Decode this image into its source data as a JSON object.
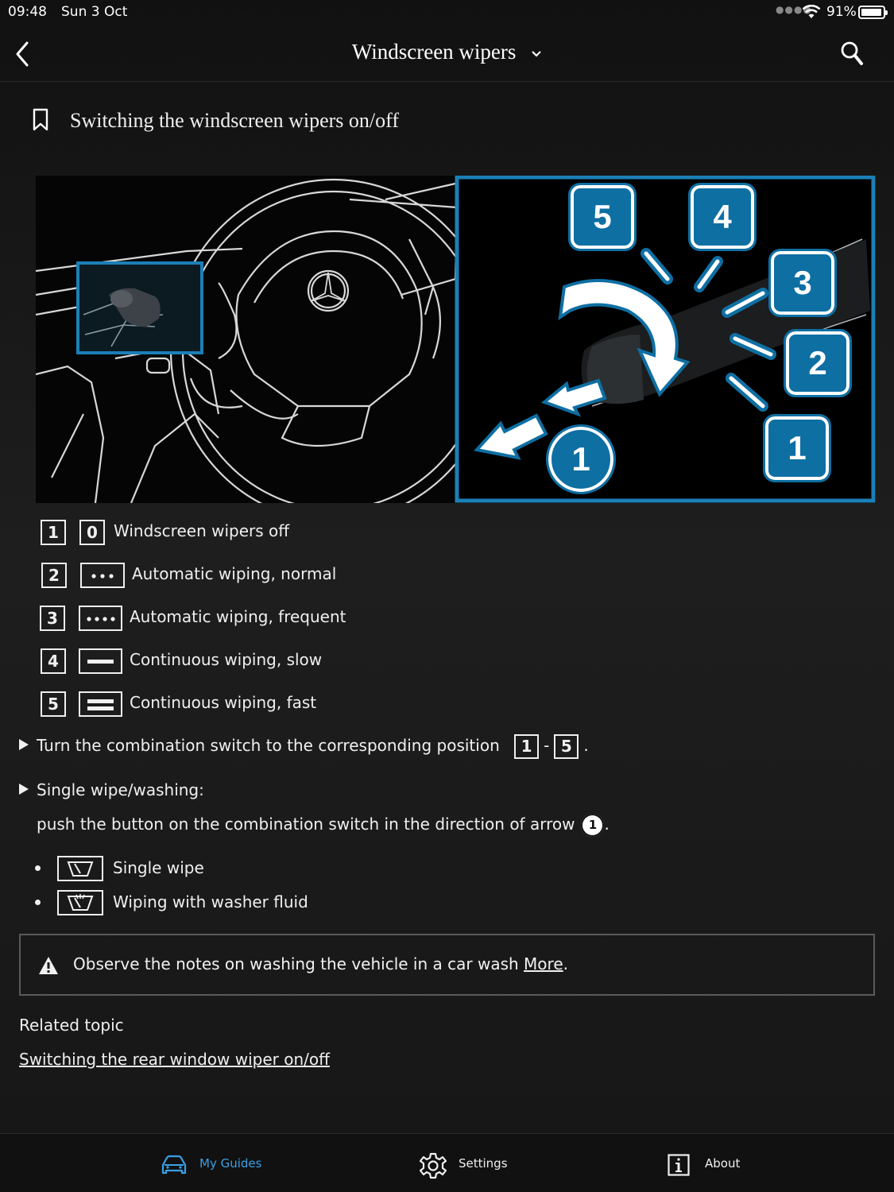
{
  "status_bar": {
    "time": "09:48",
    "date": "Sun 3 Oct",
    "battery": "91%",
    "battery_level": 0.91
  },
  "nav": {
    "title": "Windscreen wipers"
  },
  "heading": {
    "text": "Switching the windscreen wipers on/off"
  },
  "figure": {
    "callouts": [
      "1",
      "2",
      "3",
      "4",
      "5"
    ],
    "arrow_label": "1",
    "accent_color": "#0e6fa3"
  },
  "legend": [
    {
      "num": "1",
      "symbol": "0",
      "text": "Windscreen wipers off"
    },
    {
      "num": "2",
      "symbol": "dots-3",
      "text": "Automatic wiping, normal"
    },
    {
      "num": "3",
      "symbol": "dots-4",
      "text": "Automatic wiping, frequent"
    },
    {
      "num": "4",
      "symbol": "line-1",
      "text": "Continuous wiping, slow"
    },
    {
      "num": "5",
      "symbol": "line-2",
      "text": "Continuous wiping, fast"
    }
  ],
  "steps": {
    "turn_text": "Turn the combination switch to the corresponding position",
    "range_from": "1",
    "range_sep": "-",
    "range_to": "5",
    "period": ".",
    "single_wipe_title": "Single wipe/washing:",
    "push_text": "push the button on the combination switch in the direction of arrow",
    "arrow_num": "1"
  },
  "bullets": [
    {
      "icon": "wiper-icon",
      "text": "Single wipe"
    },
    {
      "icon": "washer-fluid-icon",
      "text": "Wiping with washer fluid"
    }
  ],
  "warning": {
    "text": "Observe the notes on washing the vehicle in a car wash",
    "link": "More",
    "period": "."
  },
  "related": {
    "label": "Related topic",
    "link": "Switching the rear window wiper on/off"
  },
  "tabs": [
    {
      "label": "My Guides",
      "icon": "car-icon",
      "active": true
    },
    {
      "label": "Settings",
      "icon": "gear-icon",
      "active": false
    },
    {
      "label": "About",
      "icon": "info-icon",
      "active": false
    }
  ]
}
